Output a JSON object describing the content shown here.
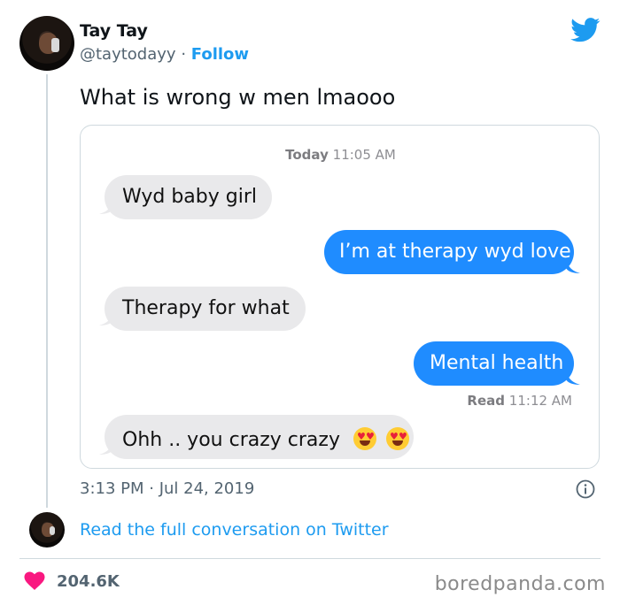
{
  "tweet": {
    "author_name": "Tay Tay",
    "handle": "@taytodayy",
    "separator": "·",
    "follow_label": "Follow",
    "text": "What is wrong w men lmaooo",
    "datetime": "3:13 PM · Jul 24, 2019",
    "read_more": "Read the full conversation on Twitter",
    "likes": "204.6K"
  },
  "chat": {
    "timestamp_day": "Today",
    "timestamp_time": "11:05 AM",
    "messages": [
      {
        "side": "in",
        "text": "Wyd baby girl"
      },
      {
        "side": "out",
        "text": "I’m at therapy wyd love"
      },
      {
        "side": "in",
        "text": "Therapy for what"
      },
      {
        "side": "out",
        "text": "Mental health"
      },
      {
        "side": "in",
        "text": "Ohh .. you crazy crazy"
      }
    ],
    "read_label": "Read",
    "read_time": "11:12 AM"
  },
  "icons": {
    "brand": "twitter-bird-icon",
    "info": "info-icon",
    "like": "heart-icon",
    "emoji": "heart-eyes-emoji"
  },
  "colors": {
    "twitter_blue": "#1d9bf0",
    "imessage_blue": "#1f8cff",
    "incoming_bubble": "#e9e9eb",
    "heart": "#f91880"
  },
  "watermark": "boredpanda.com"
}
